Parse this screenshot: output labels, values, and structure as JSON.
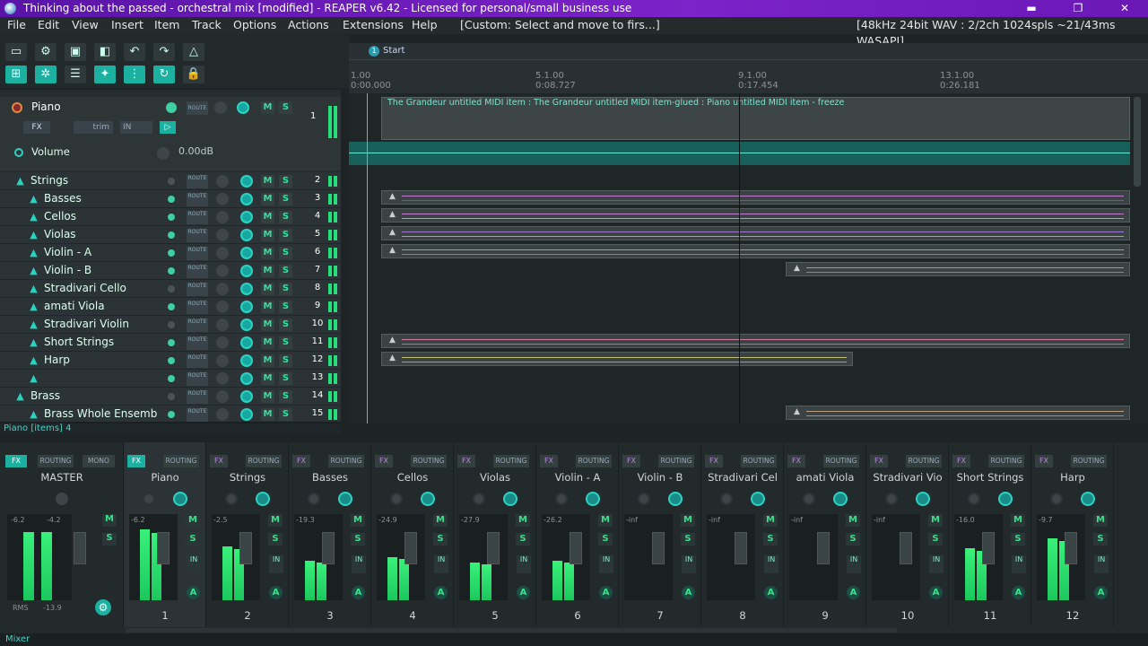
{
  "window": {
    "title": "Thinking about the passed - orchestral mix [modified] - REAPER v6.42 - Licensed for personal/small business use",
    "minimize": "▬",
    "restore": "❐",
    "close": "✕"
  },
  "menu": {
    "items": [
      "File",
      "Edit",
      "View",
      "Insert",
      "Item",
      "Track",
      "Options",
      "Actions",
      "Extensions",
      "Help"
    ],
    "custom_action": "[Custom: Select and move to firs...]",
    "audio_status": "[48kHz 24bit WAV : 2/2ch 1024spls ~21/43ms WASAPI]"
  },
  "piano_track": {
    "name": "Piano",
    "number": "1",
    "volume_label": "Volume",
    "volume_value": "0.00dB",
    "fx": "FX",
    "trim": "trim",
    "in": "IN",
    "route": "ROUTE",
    "mute": "M",
    "solo": "S"
  },
  "tracks": [
    {
      "name": "Strings",
      "num": "2",
      "folder": true
    },
    {
      "name": "Basses",
      "num": "3"
    },
    {
      "name": "Cellos",
      "num": "4"
    },
    {
      "name": "Violas",
      "num": "5"
    },
    {
      "name": "Violin - A",
      "num": "6"
    },
    {
      "name": "Violin - B",
      "num": "7"
    },
    {
      "name": "Stradivari Cello",
      "num": "8"
    },
    {
      "name": "amati Viola",
      "num": "9"
    },
    {
      "name": "Stradivari Violin",
      "num": "10"
    },
    {
      "name": "Short Strings",
      "num": "11"
    },
    {
      "name": "Harp",
      "num": "12"
    },
    {
      "name": "",
      "num": "13"
    },
    {
      "name": "Brass",
      "num": "14",
      "folder": true
    },
    {
      "name": "Brass Whole Ensemb",
      "num": "15"
    }
  ],
  "tcp_status": "Piano [items] 4",
  "arrange": {
    "marker_num": "1",
    "marker_name": "Start",
    "ruler": [
      {
        "bar": "1.00",
        "time": "0:00.000"
      },
      {
        "bar": "5.1.00",
        "time": "0:08.727"
      },
      {
        "bar": "9.1.00",
        "time": "0:17.454"
      },
      {
        "bar": "13.1.00",
        "time": "0:26.181"
      }
    ],
    "item_label": "The Grandeur untitled MIDI item : The Grandeur untitled MIDI item-glued : Piano untitled MIDI item - freeze",
    "lock_icon": "🔒"
  },
  "mixer": {
    "master": {
      "name": "MASTER",
      "fx": "FX",
      "routing": "ROUTING",
      "mono": "MONO",
      "db_l": "-6.2",
      "db_r": "-4.2",
      "rms": "RMS",
      "rms_val": "-13.9"
    },
    "strips": [
      {
        "name": "Piano",
        "num": "1",
        "db": "-6.2"
      },
      {
        "name": "Strings",
        "num": "2",
        "db": "-2.5"
      },
      {
        "name": "Basses",
        "num": "3",
        "db": "-19.3"
      },
      {
        "name": "Cellos",
        "num": "4",
        "db": "-24.9"
      },
      {
        "name": "Violas",
        "num": "5",
        "db": "-27.9"
      },
      {
        "name": "Violin - A",
        "num": "6",
        "db": "-26.2"
      },
      {
        "name": "Violin - B",
        "num": "7",
        "db": "-inf"
      },
      {
        "name": "Stradivari Cel",
        "num": "8",
        "db": "-inf"
      },
      {
        "name": "amati Viola",
        "num": "9",
        "db": "-inf"
      },
      {
        "name": "Stradivari Vio",
        "num": "10",
        "db": "-inf"
      },
      {
        "name": "Short Strings",
        "num": "11",
        "db": "-16.0"
      },
      {
        "name": "Harp",
        "num": "12",
        "db": "-9.7"
      }
    ],
    "fx": "FX",
    "routing": "ROUTING",
    "mute": "M",
    "solo": "S",
    "in": "IN",
    "auto": "A"
  },
  "statusbar": {
    "label": "Mixer"
  }
}
